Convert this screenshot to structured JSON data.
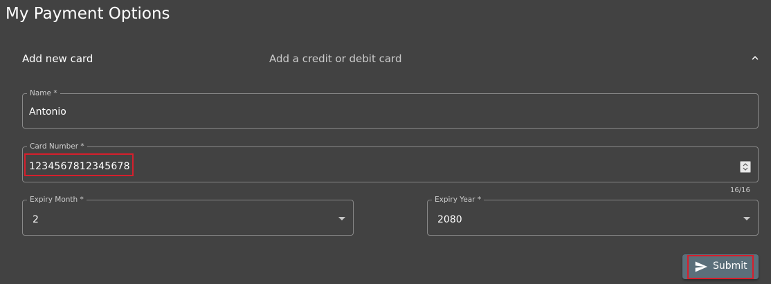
{
  "page": {
    "title": "My Payment Options"
  },
  "panel": {
    "title": "Add new card",
    "description": "Add a credit or debit card",
    "expand_icon": "chevron-up-icon"
  },
  "form": {
    "name": {
      "label": "Name *",
      "value": "Antonio"
    },
    "card_number": {
      "label": "Card Number *",
      "value": "1234567812345678",
      "counter": "16/16",
      "highlighted": true
    },
    "expiry_month": {
      "label": "Expiry Month *",
      "value": "2"
    },
    "expiry_year": {
      "label": "Expiry Year *",
      "value": "2080"
    },
    "submit": {
      "label": "Submit",
      "icon": "send-icon",
      "highlighted": true
    }
  },
  "colors": {
    "background": "#424242",
    "submit_button": "#5b6f7a",
    "highlight": "#d61f2c"
  }
}
